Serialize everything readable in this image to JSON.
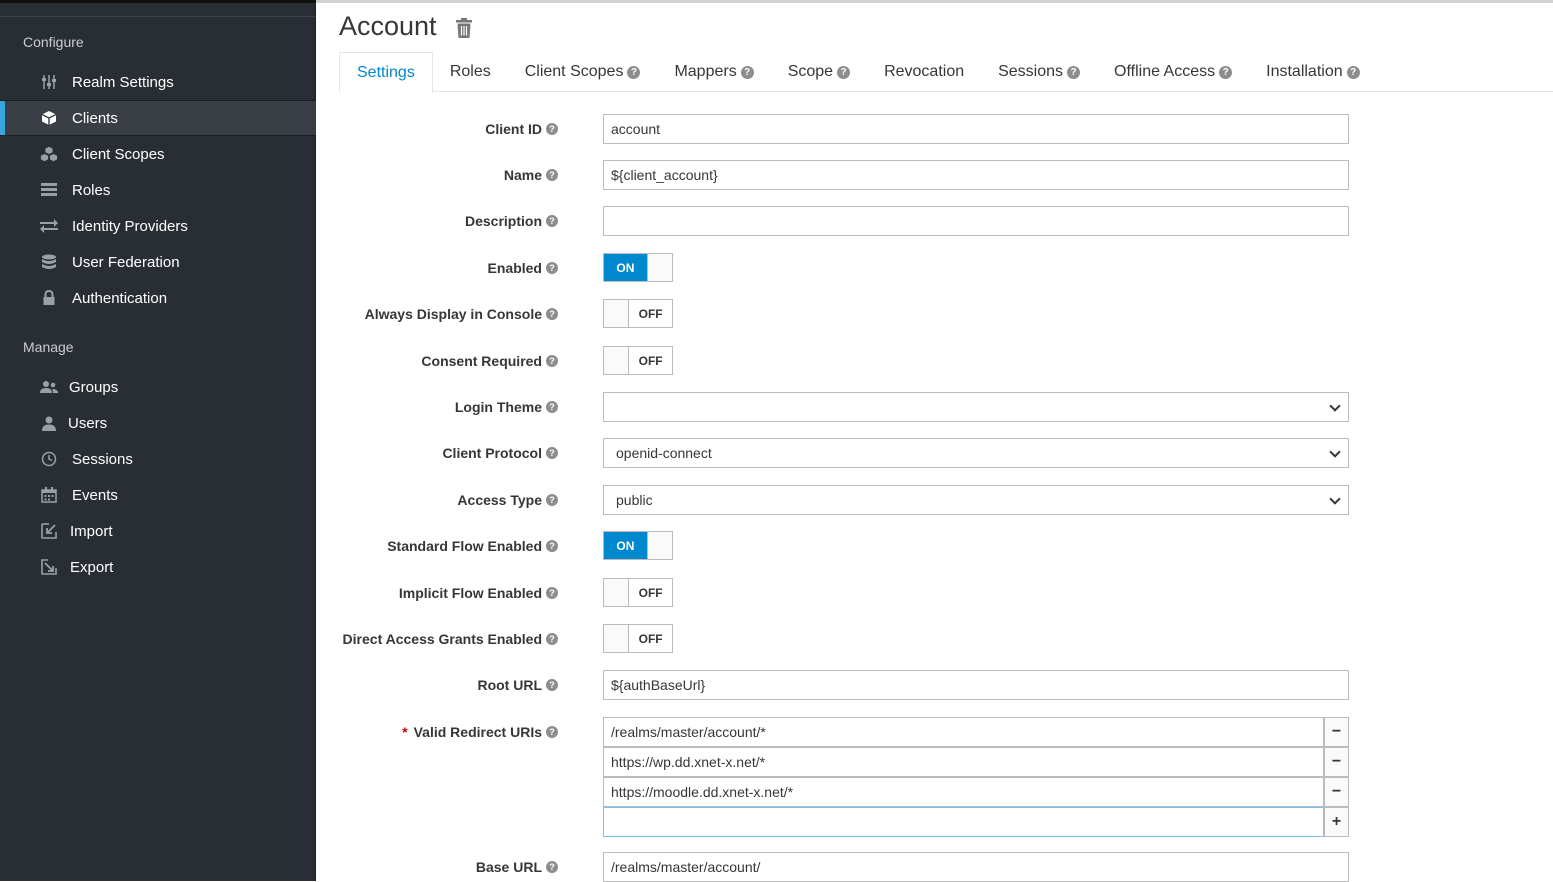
{
  "sidebar": {
    "configure_title": "Configure",
    "configure_items": [
      {
        "label": "Realm Settings",
        "icon": "sliders-icon"
      },
      {
        "label": "Clients",
        "icon": "cube-icon"
      },
      {
        "label": "Client Scopes",
        "icon": "cubes-icon"
      },
      {
        "label": "Roles",
        "icon": "list-icon"
      },
      {
        "label": "Identity Providers",
        "icon": "exchange-icon"
      },
      {
        "label": "User Federation",
        "icon": "database-icon"
      },
      {
        "label": "Authentication",
        "icon": "lock-icon"
      }
    ],
    "manage_title": "Manage",
    "manage_items": [
      {
        "label": "Groups",
        "icon": "users-icon"
      },
      {
        "label": "Users",
        "icon": "user-icon"
      },
      {
        "label": "Sessions",
        "icon": "clock-icon"
      },
      {
        "label": "Events",
        "icon": "calendar-icon"
      },
      {
        "label": "Import",
        "icon": "import-icon"
      },
      {
        "label": "Export",
        "icon": "export-icon"
      }
    ],
    "active": "Clients",
    "accent_color": "#39a5dc"
  },
  "header": {
    "title": "Account"
  },
  "tabs": [
    {
      "label": "Settings",
      "help": false
    },
    {
      "label": "Roles",
      "help": false
    },
    {
      "label": "Client Scopes",
      "help": true
    },
    {
      "label": "Mappers",
      "help": true
    },
    {
      "label": "Scope",
      "help": true
    },
    {
      "label": "Revocation",
      "help": false
    },
    {
      "label": "Sessions",
      "help": true
    },
    {
      "label": "Offline Access",
      "help": true
    },
    {
      "label": "Installation",
      "help": true
    }
  ],
  "form": {
    "client_id": {
      "label": "Client ID",
      "value": "account"
    },
    "name": {
      "label": "Name",
      "value": "${client_account}"
    },
    "description": {
      "label": "Description",
      "value": ""
    },
    "enabled": {
      "label": "Enabled",
      "state": "ON"
    },
    "always_display": {
      "label": "Always Display in Console",
      "state": "OFF"
    },
    "consent_required": {
      "label": "Consent Required",
      "state": "OFF"
    },
    "login_theme": {
      "label": "Login Theme",
      "value": ""
    },
    "client_protocol": {
      "label": "Client Protocol",
      "value": "openid-connect"
    },
    "access_type": {
      "label": "Access Type",
      "value": "public"
    },
    "standard_flow": {
      "label": "Standard Flow Enabled",
      "state": "ON"
    },
    "implicit_flow": {
      "label": "Implicit Flow Enabled",
      "state": "OFF"
    },
    "direct_access": {
      "label": "Direct Access Grants Enabled",
      "state": "OFF"
    },
    "root_url": {
      "label": "Root URL",
      "value": "${authBaseUrl}"
    },
    "redirect_uris": {
      "label": "Valid Redirect URIs",
      "required_mark": "*",
      "values": [
        "/realms/master/account/*",
        "https://wp.dd.xnet-x.net/*",
        "https://moodle.dd.xnet-x.net/*",
        ""
      ]
    },
    "base_url": {
      "label": "Base URL",
      "value": "/realms/master/account/"
    }
  },
  "symbols": {
    "help": "?",
    "minus": "−",
    "plus": "+"
  }
}
